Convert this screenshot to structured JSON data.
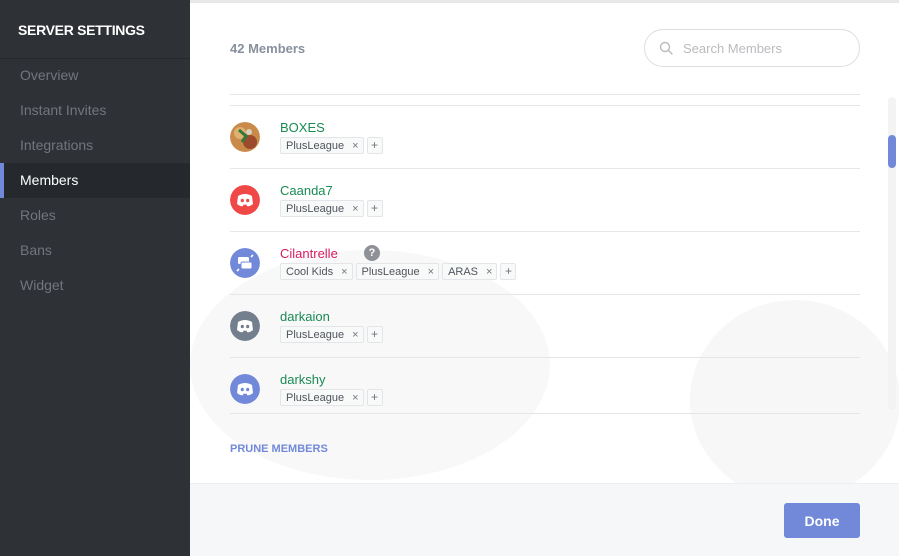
{
  "sidebar": {
    "title": "SERVER SETTINGS",
    "items": [
      {
        "label": "Overview",
        "active": false
      },
      {
        "label": "Instant Invites",
        "active": false
      },
      {
        "label": "Integrations",
        "active": false
      },
      {
        "label": "Members",
        "active": true
      },
      {
        "label": "Roles",
        "active": false
      },
      {
        "label": "Bans",
        "active": false
      },
      {
        "label": "Widget",
        "active": false
      }
    ]
  },
  "members": {
    "count_label": "42 Members",
    "search_placeholder": "Search Members",
    "list": [
      {
        "name": "BOXES",
        "name_color": "#1a8a53",
        "avatar": "boxes-avatar",
        "roles": [
          "PlusLeague"
        ]
      },
      {
        "name": "Caanda7",
        "name_color": "#1a8a53",
        "avatar": "discord-red-avatar",
        "roles": [
          "PlusLeague"
        ]
      },
      {
        "name": "Cilantrelle",
        "name_color": "#d81b60",
        "avatar": "discord-swap-avatar",
        "has_help_icon": true,
        "help_glyph": "?",
        "roles": [
          "Cool Kids",
          "PlusLeague",
          "ARAS"
        ]
      },
      {
        "name": "darkaion",
        "name_color": "#1a8a53",
        "avatar": "discord-gray-avatar",
        "roles": [
          "PlusLeague"
        ]
      },
      {
        "name": "darkshy",
        "name_color": "#1a8a53",
        "avatar": "discord-blurple-avatar",
        "roles": [
          "PlusLeague"
        ]
      }
    ],
    "role_remove_glyph": "×",
    "role_add_glyph": "+",
    "prune_label": "PRUNE MEMBERS"
  },
  "footer": {
    "done_label": "Done"
  },
  "colors": {
    "accent": "#7289da",
    "sidebar_bg": "#2e3136",
    "role_green": "#1a8a53",
    "role_pink": "#d81b60"
  }
}
